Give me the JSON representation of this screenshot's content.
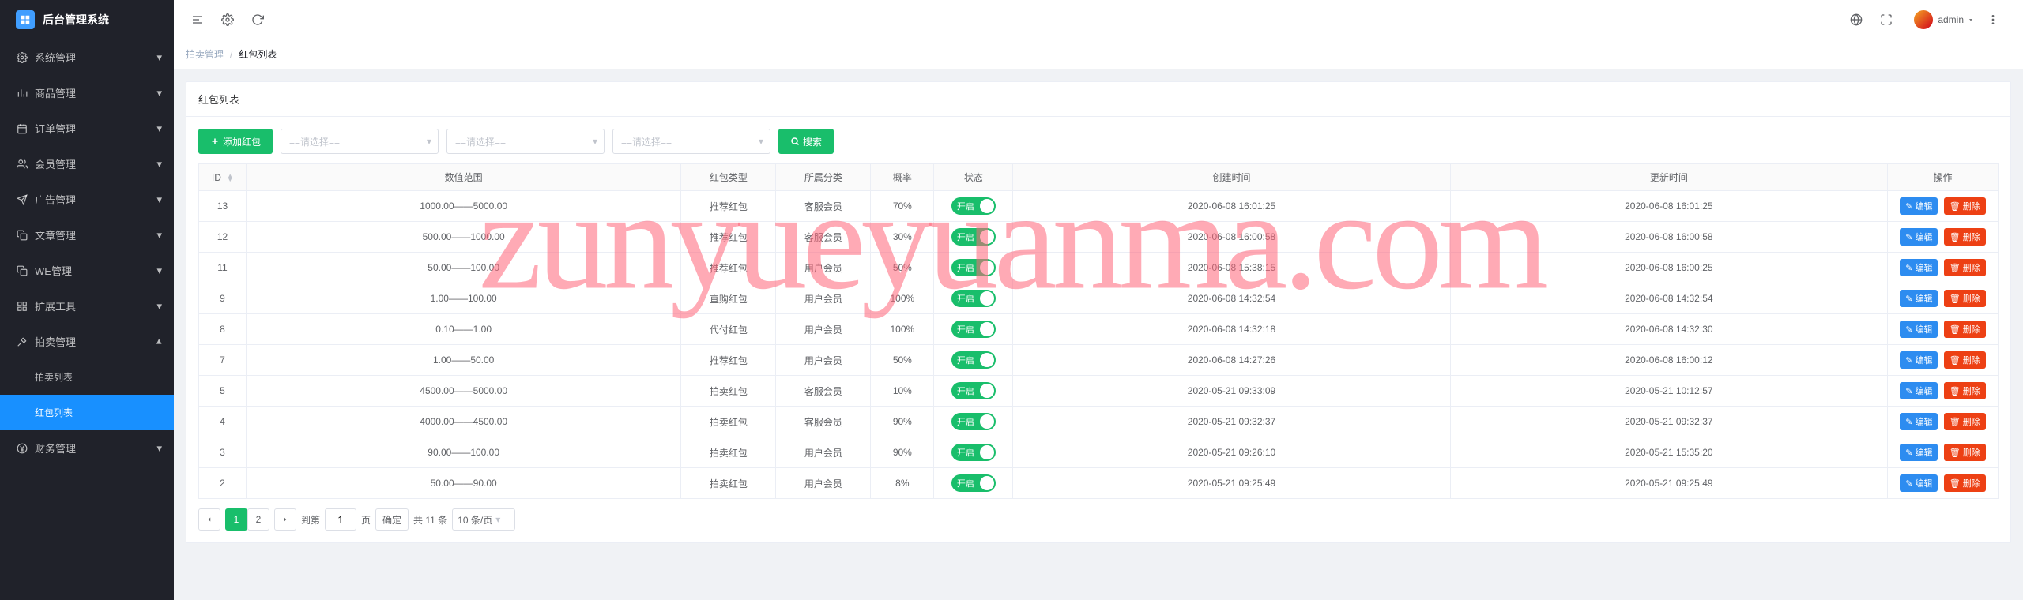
{
  "app_title": "后台管理系统",
  "header": {
    "username": "admin"
  },
  "sidebar": {
    "items": [
      {
        "icon": "gear",
        "label": "系统管理",
        "expanded": false
      },
      {
        "icon": "chart",
        "label": "商品管理",
        "expanded": false
      },
      {
        "icon": "calendar",
        "label": "订单管理",
        "expanded": false
      },
      {
        "icon": "users",
        "label": "会员管理",
        "expanded": false
      },
      {
        "icon": "send",
        "label": "广告管理",
        "expanded": false
      },
      {
        "icon": "copy",
        "label": "文章管理",
        "expanded": false
      },
      {
        "icon": "copy",
        "label": "WE管理",
        "expanded": false
      },
      {
        "icon": "grid",
        "label": "扩展工具",
        "expanded": false
      },
      {
        "icon": "hammer",
        "label": "拍卖管理",
        "expanded": true,
        "children": [
          {
            "label": "拍卖列表",
            "active": false
          },
          {
            "label": "红包列表",
            "active": true
          }
        ]
      },
      {
        "icon": "yen",
        "label": "财务管理",
        "expanded": false
      }
    ]
  },
  "breadcrumb": {
    "parent": "拍卖管理",
    "current": "红包列表"
  },
  "card_title": "红包列表",
  "toolbar": {
    "add_label": "添加红包",
    "select_placeholder": "==请选择==",
    "search_label": "搜索"
  },
  "table": {
    "headers": {
      "id": "ID",
      "range": "数值范围",
      "type": "红包类型",
      "category": "所属分类",
      "rate": "概率",
      "status": "状态",
      "created": "创建时间",
      "updated": "更新时间",
      "action": "操作"
    },
    "status_on_label": "开启",
    "edit_label": "编辑",
    "delete_label": "删除",
    "rows": [
      {
        "id": "13",
        "range": "1000.00——5000.00",
        "type": "推荐红包",
        "category": "客服会员",
        "rate": "70%",
        "created": "2020-06-08 16:01:25",
        "updated": "2020-06-08 16:01:25"
      },
      {
        "id": "12",
        "range": "500.00——1000.00",
        "type": "推荐红包",
        "category": "客服会员",
        "rate": "30%",
        "created": "2020-06-08 16:00:58",
        "updated": "2020-06-08 16:00:58"
      },
      {
        "id": "11",
        "range": "50.00——100.00",
        "type": "推荐红包",
        "category": "用户会员",
        "rate": "50%",
        "created": "2020-06-08 15:38:15",
        "updated": "2020-06-08 16:00:25"
      },
      {
        "id": "9",
        "range": "1.00——100.00",
        "type": "直购红包",
        "category": "用户会员",
        "rate": "100%",
        "created": "2020-06-08 14:32:54",
        "updated": "2020-06-08 14:32:54"
      },
      {
        "id": "8",
        "range": "0.10——1.00",
        "type": "代付红包",
        "category": "用户会员",
        "rate": "100%",
        "created": "2020-06-08 14:32:18",
        "updated": "2020-06-08 14:32:30"
      },
      {
        "id": "7",
        "range": "1.00——50.00",
        "type": "推荐红包",
        "category": "用户会员",
        "rate": "50%",
        "created": "2020-06-08 14:27:26",
        "updated": "2020-06-08 16:00:12"
      },
      {
        "id": "5",
        "range": "4500.00——5000.00",
        "type": "拍卖红包",
        "category": "客服会员",
        "rate": "10%",
        "created": "2020-05-21 09:33:09",
        "updated": "2020-05-21 10:12:57"
      },
      {
        "id": "4",
        "range": "4000.00——4500.00",
        "type": "拍卖红包",
        "category": "客服会员",
        "rate": "90%",
        "created": "2020-05-21 09:32:37",
        "updated": "2020-05-21 09:32:37"
      },
      {
        "id": "3",
        "range": "90.00——100.00",
        "type": "拍卖红包",
        "category": "用户会员",
        "rate": "90%",
        "created": "2020-05-21 09:26:10",
        "updated": "2020-05-21 15:35:20"
      },
      {
        "id": "2",
        "range": "50.00——90.00",
        "type": "拍卖红包",
        "category": "用户会员",
        "rate": "8%",
        "created": "2020-05-21 09:25:49",
        "updated": "2020-05-21 09:25:49"
      }
    ]
  },
  "pager": {
    "pages": [
      "1",
      "2"
    ],
    "active": "1",
    "goto_label": "到第",
    "goto_value": "1",
    "page_label": "页",
    "confirm_label": "确定",
    "total_label": "共 11 条",
    "size_label": "10 条/页"
  },
  "watermark": "zunyueyuanma.com"
}
